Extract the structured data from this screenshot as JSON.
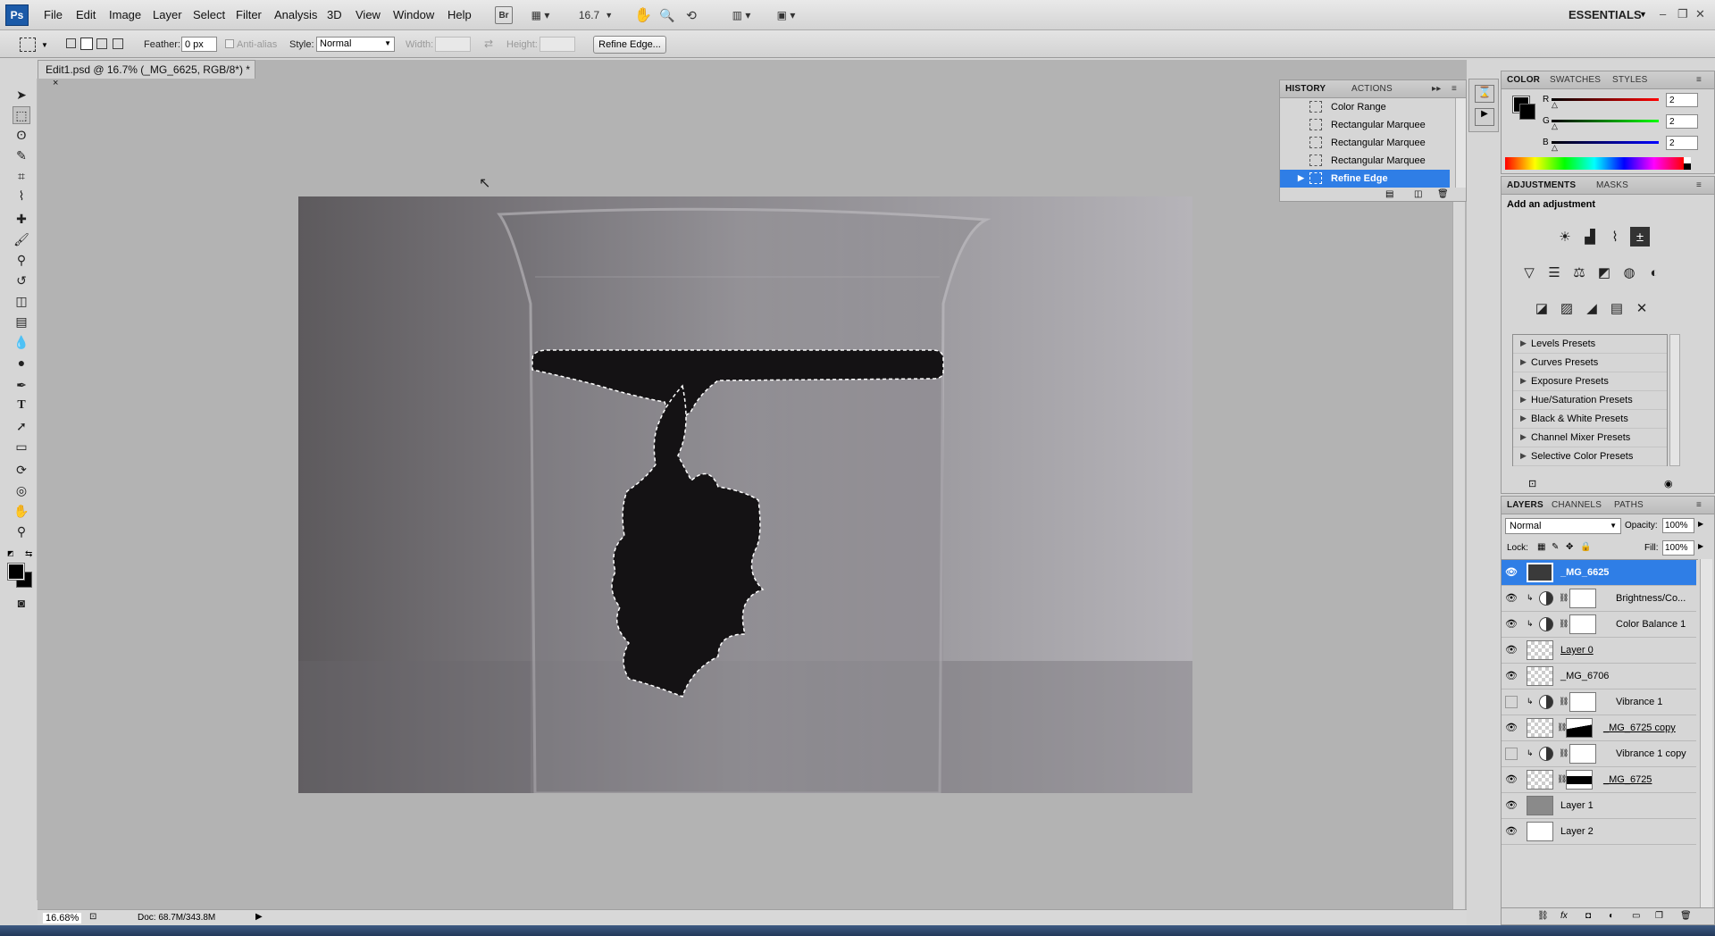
{
  "app": {
    "logo": "Ps",
    "workspace": "ESSENTIALS"
  },
  "menu": [
    "File",
    "Edit",
    "Image",
    "Layer",
    "Select",
    "Filter",
    "Analysis",
    "3D",
    "View",
    "Window",
    "Help"
  ],
  "toolbar": {
    "bridge": "Br",
    "zoom_value": "16.7"
  },
  "options": {
    "feather_label": "Feather:",
    "feather_value": "0 px",
    "antialias_label": "Anti-alias",
    "style_label": "Style:",
    "style_value": "Normal",
    "width_label": "Width:",
    "height_label": "Height:",
    "refine_edge": "Refine Edge..."
  },
  "document": {
    "tab_title": "Edit1.psd @ 16.7% (_MG_6625, RGB/8*) *",
    "close": "×"
  },
  "status": {
    "zoom": "16.68%",
    "doc_size": "Doc: 68.7M/343.8M"
  },
  "history": {
    "tabs": [
      "HISTORY",
      "ACTIONS"
    ],
    "items": [
      {
        "label": "Color Range"
      },
      {
        "label": "Rectangular Marquee"
      },
      {
        "label": "Rectangular Marquee"
      },
      {
        "label": "Rectangular Marquee"
      },
      {
        "label": "Refine Edge"
      }
    ]
  },
  "color_panel": {
    "tabs": [
      "COLOR",
      "SWATCHES",
      "STYLES"
    ],
    "channels": [
      {
        "label": "R",
        "value": "2",
        "color": "#e02020"
      },
      {
        "label": "G",
        "value": "2",
        "color": "#20c020"
      },
      {
        "label": "B",
        "value": "2",
        "color": "#2040e0"
      }
    ]
  },
  "adjustments": {
    "tabs": [
      "ADJUSTMENTS",
      "MASKS"
    ],
    "heading": "Add an adjustment",
    "presets": [
      "Levels Presets",
      "Curves Presets",
      "Exposure Presets",
      "Hue/Saturation Presets",
      "Black & White Presets",
      "Channel Mixer Presets",
      "Selective Color Presets"
    ]
  },
  "layers": {
    "tabs": [
      "LAYERS",
      "CHANNELS",
      "PATHS"
    ],
    "blend_mode": "Normal",
    "opacity_label": "Opacity:",
    "opacity_value": "100%",
    "lock_label": "Lock:",
    "fill_label": "Fill:",
    "fill_value": "100%",
    "items": [
      {
        "name": "_MG_6625",
        "visible": true,
        "selected": true
      },
      {
        "name": "Brightness/Co...",
        "visible": true
      },
      {
        "name": "Color Balance 1",
        "visible": true
      },
      {
        "name": "Layer 0",
        "visible": true
      },
      {
        "name": "_MG_6706",
        "visible": true
      },
      {
        "name": "Vibrance 1",
        "visible": false
      },
      {
        "name": "_MG_6725 copy",
        "visible": true
      },
      {
        "name": "Vibrance 1 copy",
        "visible": false
      },
      {
        "name": "_MG_6725",
        "visible": true
      },
      {
        "name": "Layer 1",
        "visible": true
      },
      {
        "name": "Layer 2",
        "visible": true
      }
    ]
  },
  "colors": {
    "selection": "#2f7ee6",
    "logo_bg": "#1b5aa8"
  }
}
